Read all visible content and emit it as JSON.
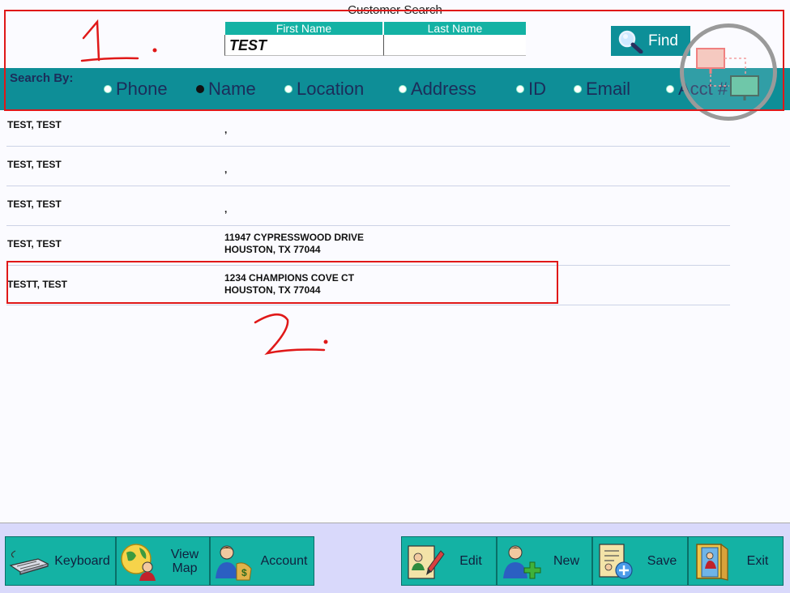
{
  "window": {
    "title": "Customer Search"
  },
  "search": {
    "first_name_label": "First Name",
    "last_name_label": "Last Name",
    "first_name_value": "TEST",
    "last_name_value": "",
    "find_label": "Find",
    "search_by_label": "Search By:",
    "options": [
      {
        "label": "Phone",
        "selected": false
      },
      {
        "label": "Name",
        "selected": true
      },
      {
        "label": "Location",
        "selected": false
      },
      {
        "label": "Address",
        "selected": false
      },
      {
        "label": "ID",
        "selected": false
      },
      {
        "label": "Email",
        "selected": false
      },
      {
        "label": "Acct #",
        "selected": false
      }
    ]
  },
  "results": [
    {
      "name": "TEST, TEST",
      "line1": ",",
      "line2": ""
    },
    {
      "name": "TEST, TEST",
      "line1": ",",
      "line2": ""
    },
    {
      "name": "TEST, TEST",
      "line1": ",",
      "line2": ""
    },
    {
      "name": "TEST, TEST",
      "line1": "11947 CYPRESSWOOD DRIVE",
      "line2": "HOUSTON, TX 77044"
    },
    {
      "name": "TESTT, TEST",
      "line1": "1234 CHAMPIONS COVE CT",
      "line2": "HOUSTON, TX 77044"
    }
  ],
  "toolbar": {
    "keyboard": "Keyboard",
    "view_map_1": "View",
    "view_map_2": "Map",
    "account": "Account",
    "edit": "Edit",
    "new": "New",
    "save": "Save",
    "exit": "Exit"
  },
  "colors": {
    "teal": "#14b2a4",
    "dark_teal": "#0e8e97",
    "annotation_red": "#e01818"
  }
}
